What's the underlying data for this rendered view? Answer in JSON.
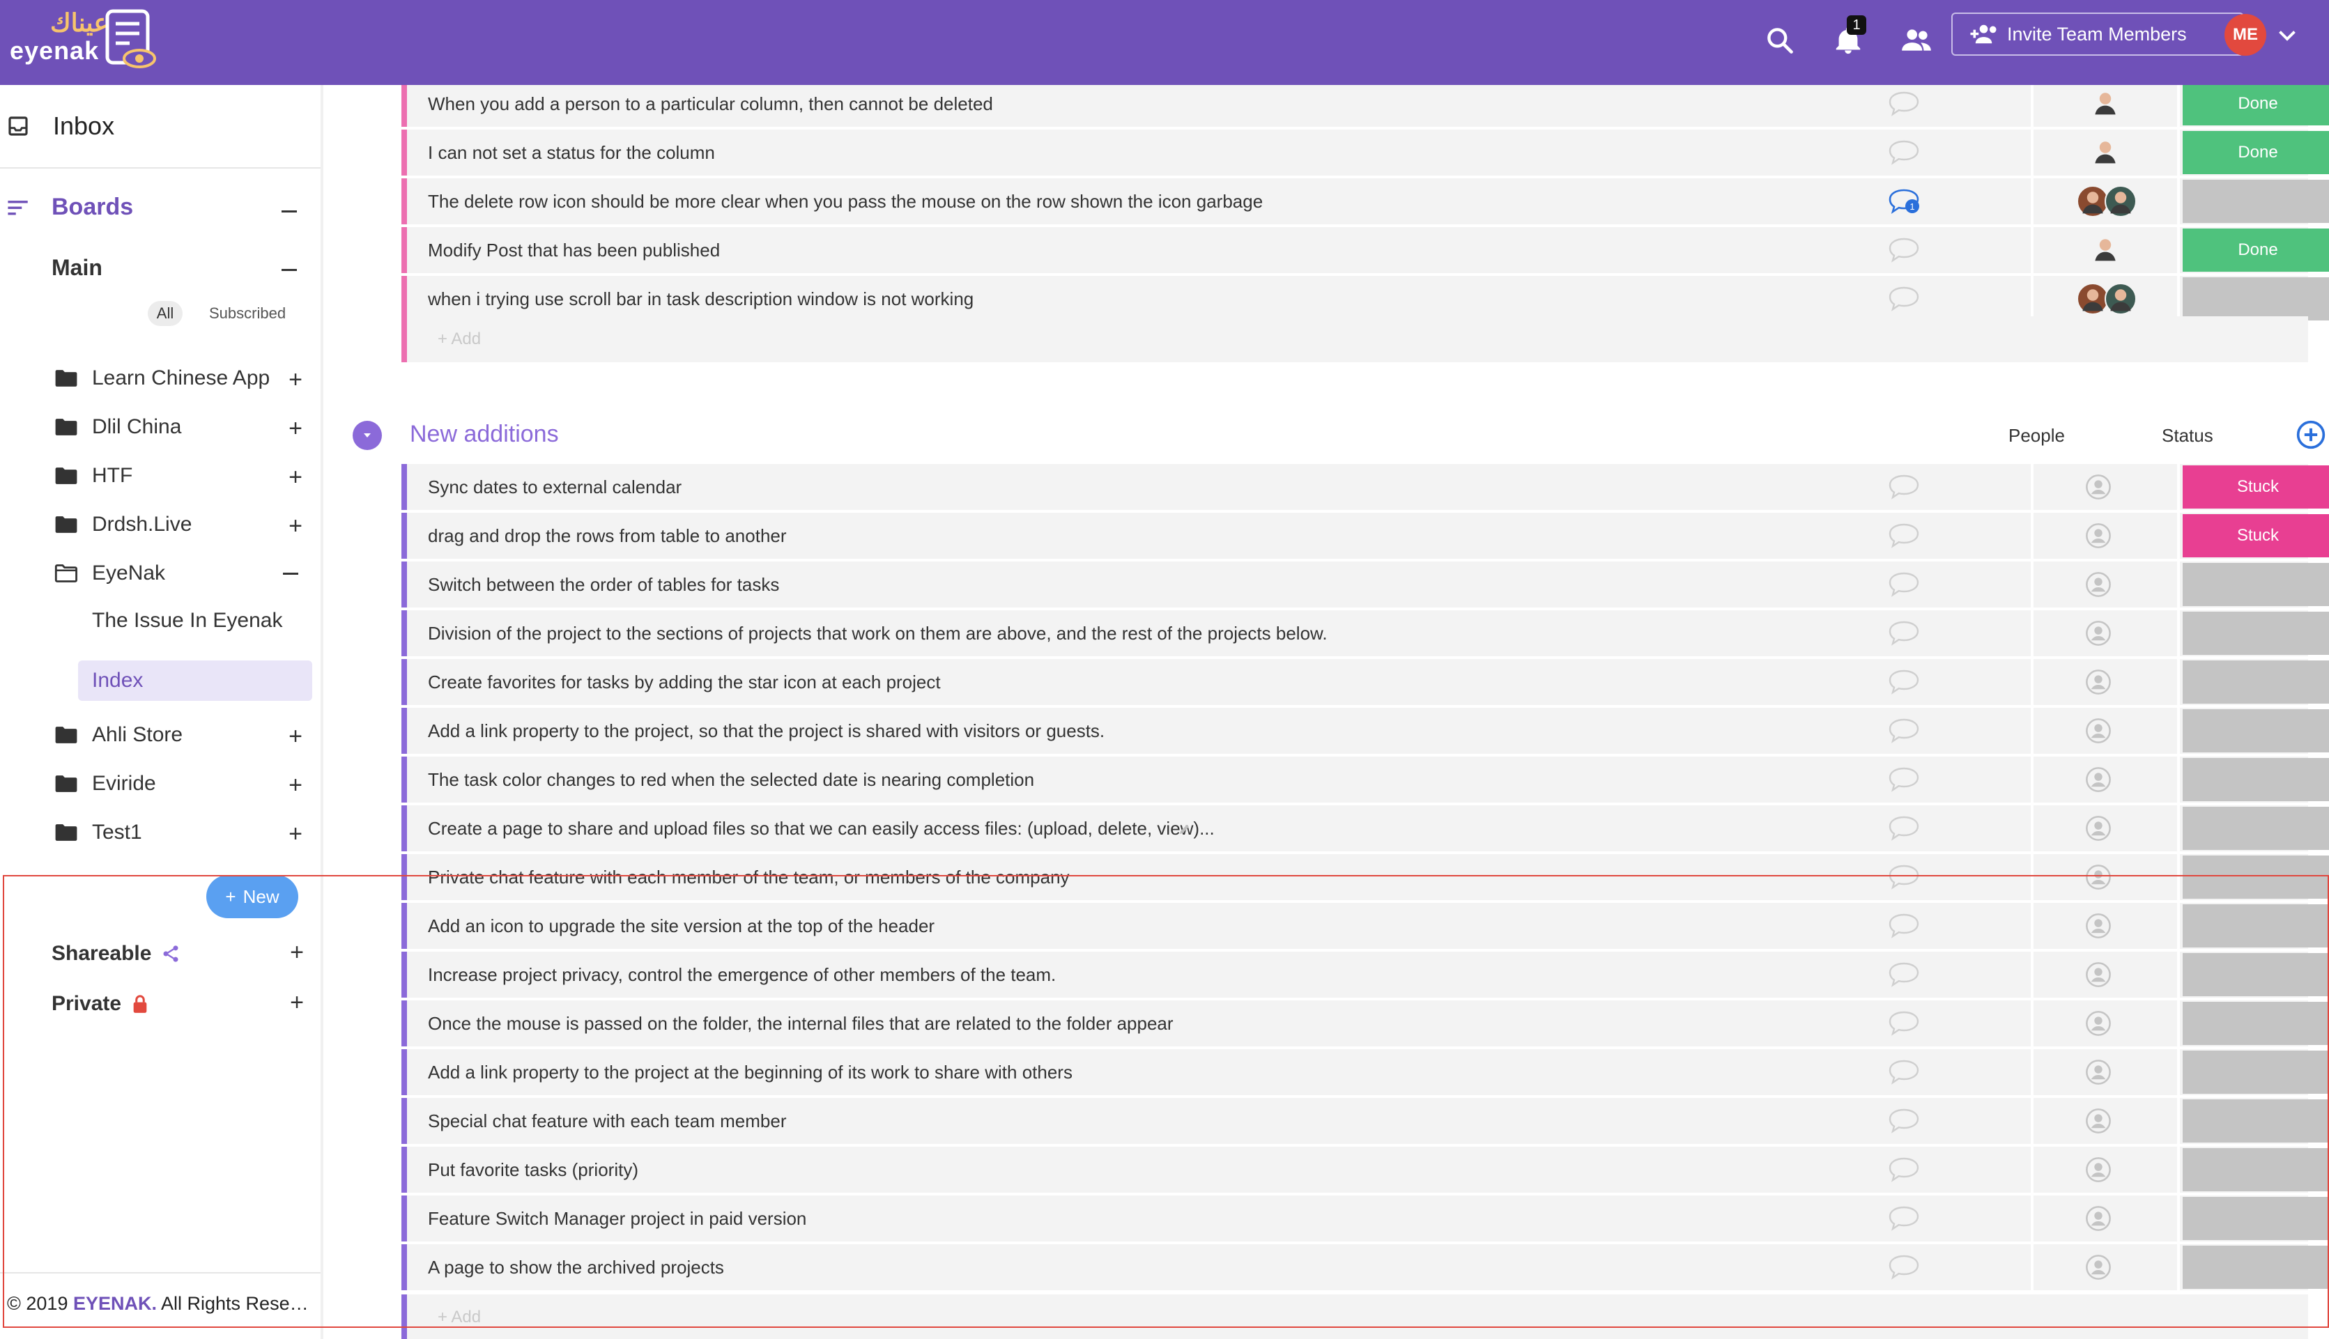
{
  "header": {
    "logo_arabic": "عيناك",
    "logo_text": "eyenak",
    "notification_count": "1",
    "invite_label": "Invite Team Members",
    "user_initials": "ME",
    "brand_color": "#6f51b8"
  },
  "sidebar": {
    "inbox_label": "Inbox",
    "boards_label": "Boards",
    "main_label": "Main",
    "filter_all": "All",
    "filter_subscribed": "Subscribed",
    "folders": [
      {
        "label": "Learn Chinese App"
      },
      {
        "label": "Dlil China"
      },
      {
        "label": "HTF"
      },
      {
        "label": "Drdsh.Live"
      },
      {
        "label": "EyeNak"
      },
      {
        "label": "Ahli Store"
      },
      {
        "label": "Eviride"
      },
      {
        "label": "Test1"
      }
    ],
    "eyenak_children": [
      {
        "label": "The Issue In Eyenak"
      },
      {
        "label": "Index"
      }
    ],
    "new_button": "New",
    "shareable_label": "Shareable",
    "private_label": "Private",
    "copyright_prefix": "© 2019 ",
    "copyright_brand": "EYENAK.",
    "copyright_suffix": " All Rights Reserv..."
  },
  "group_top": {
    "rows": [
      {
        "title": "When you add a person to a particular column, then cannot be deleted",
        "status": "Done"
      },
      {
        "title": "I can not set a status for the column",
        "status": "Done"
      },
      {
        "title": "The delete row icon should be more clear when you pass the mouse on the row shown the icon garbage",
        "status": "",
        "comment_count": "1"
      },
      {
        "title": "Modify Post that has been published",
        "status": "Done"
      },
      {
        "title": "when i trying use scroll bar in task description window is not working",
        "status": ""
      }
    ],
    "add_label": "+ Add"
  },
  "group_new": {
    "title": "New additions",
    "col_people": "People",
    "col_status": "Status",
    "rows": [
      {
        "title": "Sync dates to external calendar",
        "status": "Stuck"
      },
      {
        "title": "drag and drop the rows from table to another",
        "status": "Stuck"
      },
      {
        "title": "Switch between the order of tables for tasks",
        "status": ""
      },
      {
        "title": "Division of the project to the sections of projects that work on them are above, and the rest of the projects below.",
        "status": ""
      },
      {
        "title": "Create favorites for tasks by adding the star icon at each project",
        "status": ""
      },
      {
        "title": "Add a link property to the project, so that the project is shared with visitors or guests.",
        "status": ""
      },
      {
        "title": "The task color changes to red when the selected date is nearing completion",
        "status": ""
      },
      {
        "title": "Create a page to share and upload files so that we can easily access files: (upload, delete, view)...",
        "status": ""
      },
      {
        "title": "Private chat feature with each member of the team, or members of the company",
        "status": ""
      },
      {
        "title": "Add an icon to upgrade the site version at the top of the header",
        "status": ""
      },
      {
        "title": "Increase project privacy, control the emergence of other members of the team.",
        "status": ""
      },
      {
        "title": "Once the mouse is passed on the folder, the internal files that are related to the folder appear",
        "status": ""
      },
      {
        "title": "Add a link property to the project at the beginning of its work to share with others",
        "status": ""
      },
      {
        "title": "Special chat feature with each team member",
        "status": ""
      },
      {
        "title": "Put favorite tasks (priority)",
        "status": ""
      },
      {
        "title": "Feature Switch Manager project in paid version",
        "status": ""
      },
      {
        "title": "A page to show the archived projects",
        "status": ""
      }
    ],
    "add_label": "+ Add"
  },
  "colors": {
    "done": "#4fc27d",
    "stuck": "#e83f92",
    "empty_status": "#c4c4c4",
    "pink_group": "#ec6fb0",
    "purple_group": "#8b6ad9"
  }
}
